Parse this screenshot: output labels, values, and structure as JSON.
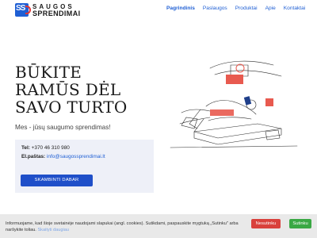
{
  "header": {
    "logo_mark": "SS",
    "logo_top": "SAUGOS",
    "logo_bottom": "SPRENDIMAI"
  },
  "nav": {
    "items": [
      {
        "label": "Pagrindinis",
        "active": true
      },
      {
        "label": "Paslaugos"
      },
      {
        "label": "Produktai"
      },
      {
        "label": "Apie"
      },
      {
        "label": "Kontaktai"
      }
    ]
  },
  "hero": {
    "title_lines": [
      "BŪKITE",
      "RAMŪS DĖL",
      "SAVO TURTO"
    ],
    "subtitle": "Mes - jūsų saugumo sprendimas!"
  },
  "contact": {
    "phone_label": "Tel:",
    "phone": "+370 46 310 980",
    "email_label": "El.paštas:",
    "email": "info@saugossprendimai.lt",
    "call_button": "SKAMBINTI DABAR"
  },
  "cookie": {
    "text": "Informuojame, kad šioje svetainėje naudojami slapukai (angl. cookies). Sutikdami, paspauskite mygtuką „Sutinku\" arba naršykite toliau.",
    "more_link": "Skaityti daugiau",
    "decline_button": "Nesutinku",
    "accept_button": "Sutinku"
  },
  "colors": {
    "accent": "#1f5fd4",
    "button": "#1f4fc9",
    "decline": "#d9413c",
    "accept": "#3aa844",
    "illustration_red": "#e85a4f"
  }
}
